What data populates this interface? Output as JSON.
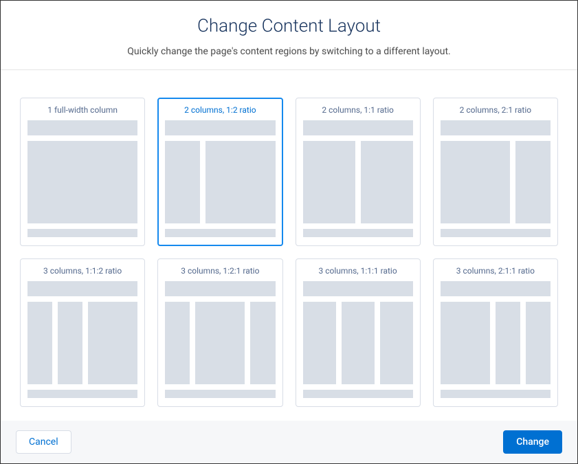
{
  "header": {
    "title": "Change Content Layout",
    "subtitle": "Quickly change the page's content regions by switching to a different layout."
  },
  "layouts": [
    {
      "label": "1 full-width column",
      "cols": [
        1
      ],
      "selected": false
    },
    {
      "label": "2 columns, 1:2 ratio",
      "cols": [
        1,
        2
      ],
      "selected": true
    },
    {
      "label": "2 columns, 1:1 ratio",
      "cols": [
        1,
        1
      ],
      "selected": false
    },
    {
      "label": "2 columns, 2:1 ratio",
      "cols": [
        2,
        1
      ],
      "selected": false
    },
    {
      "label": "3 columns, 1:1:2 ratio",
      "cols": [
        1,
        1,
        2
      ],
      "selected": false
    },
    {
      "label": "3 columns, 1:2:1 ratio",
      "cols": [
        1,
        2,
        1
      ],
      "selected": false
    },
    {
      "label": "3 columns, 1:1:1 ratio",
      "cols": [
        1,
        1,
        1
      ],
      "selected": false
    },
    {
      "label": "3 columns, 2:1:1 ratio",
      "cols": [
        2,
        1,
        1
      ],
      "selected": false
    }
  ],
  "footer": {
    "cancel_label": "Cancel",
    "change_label": "Change"
  }
}
